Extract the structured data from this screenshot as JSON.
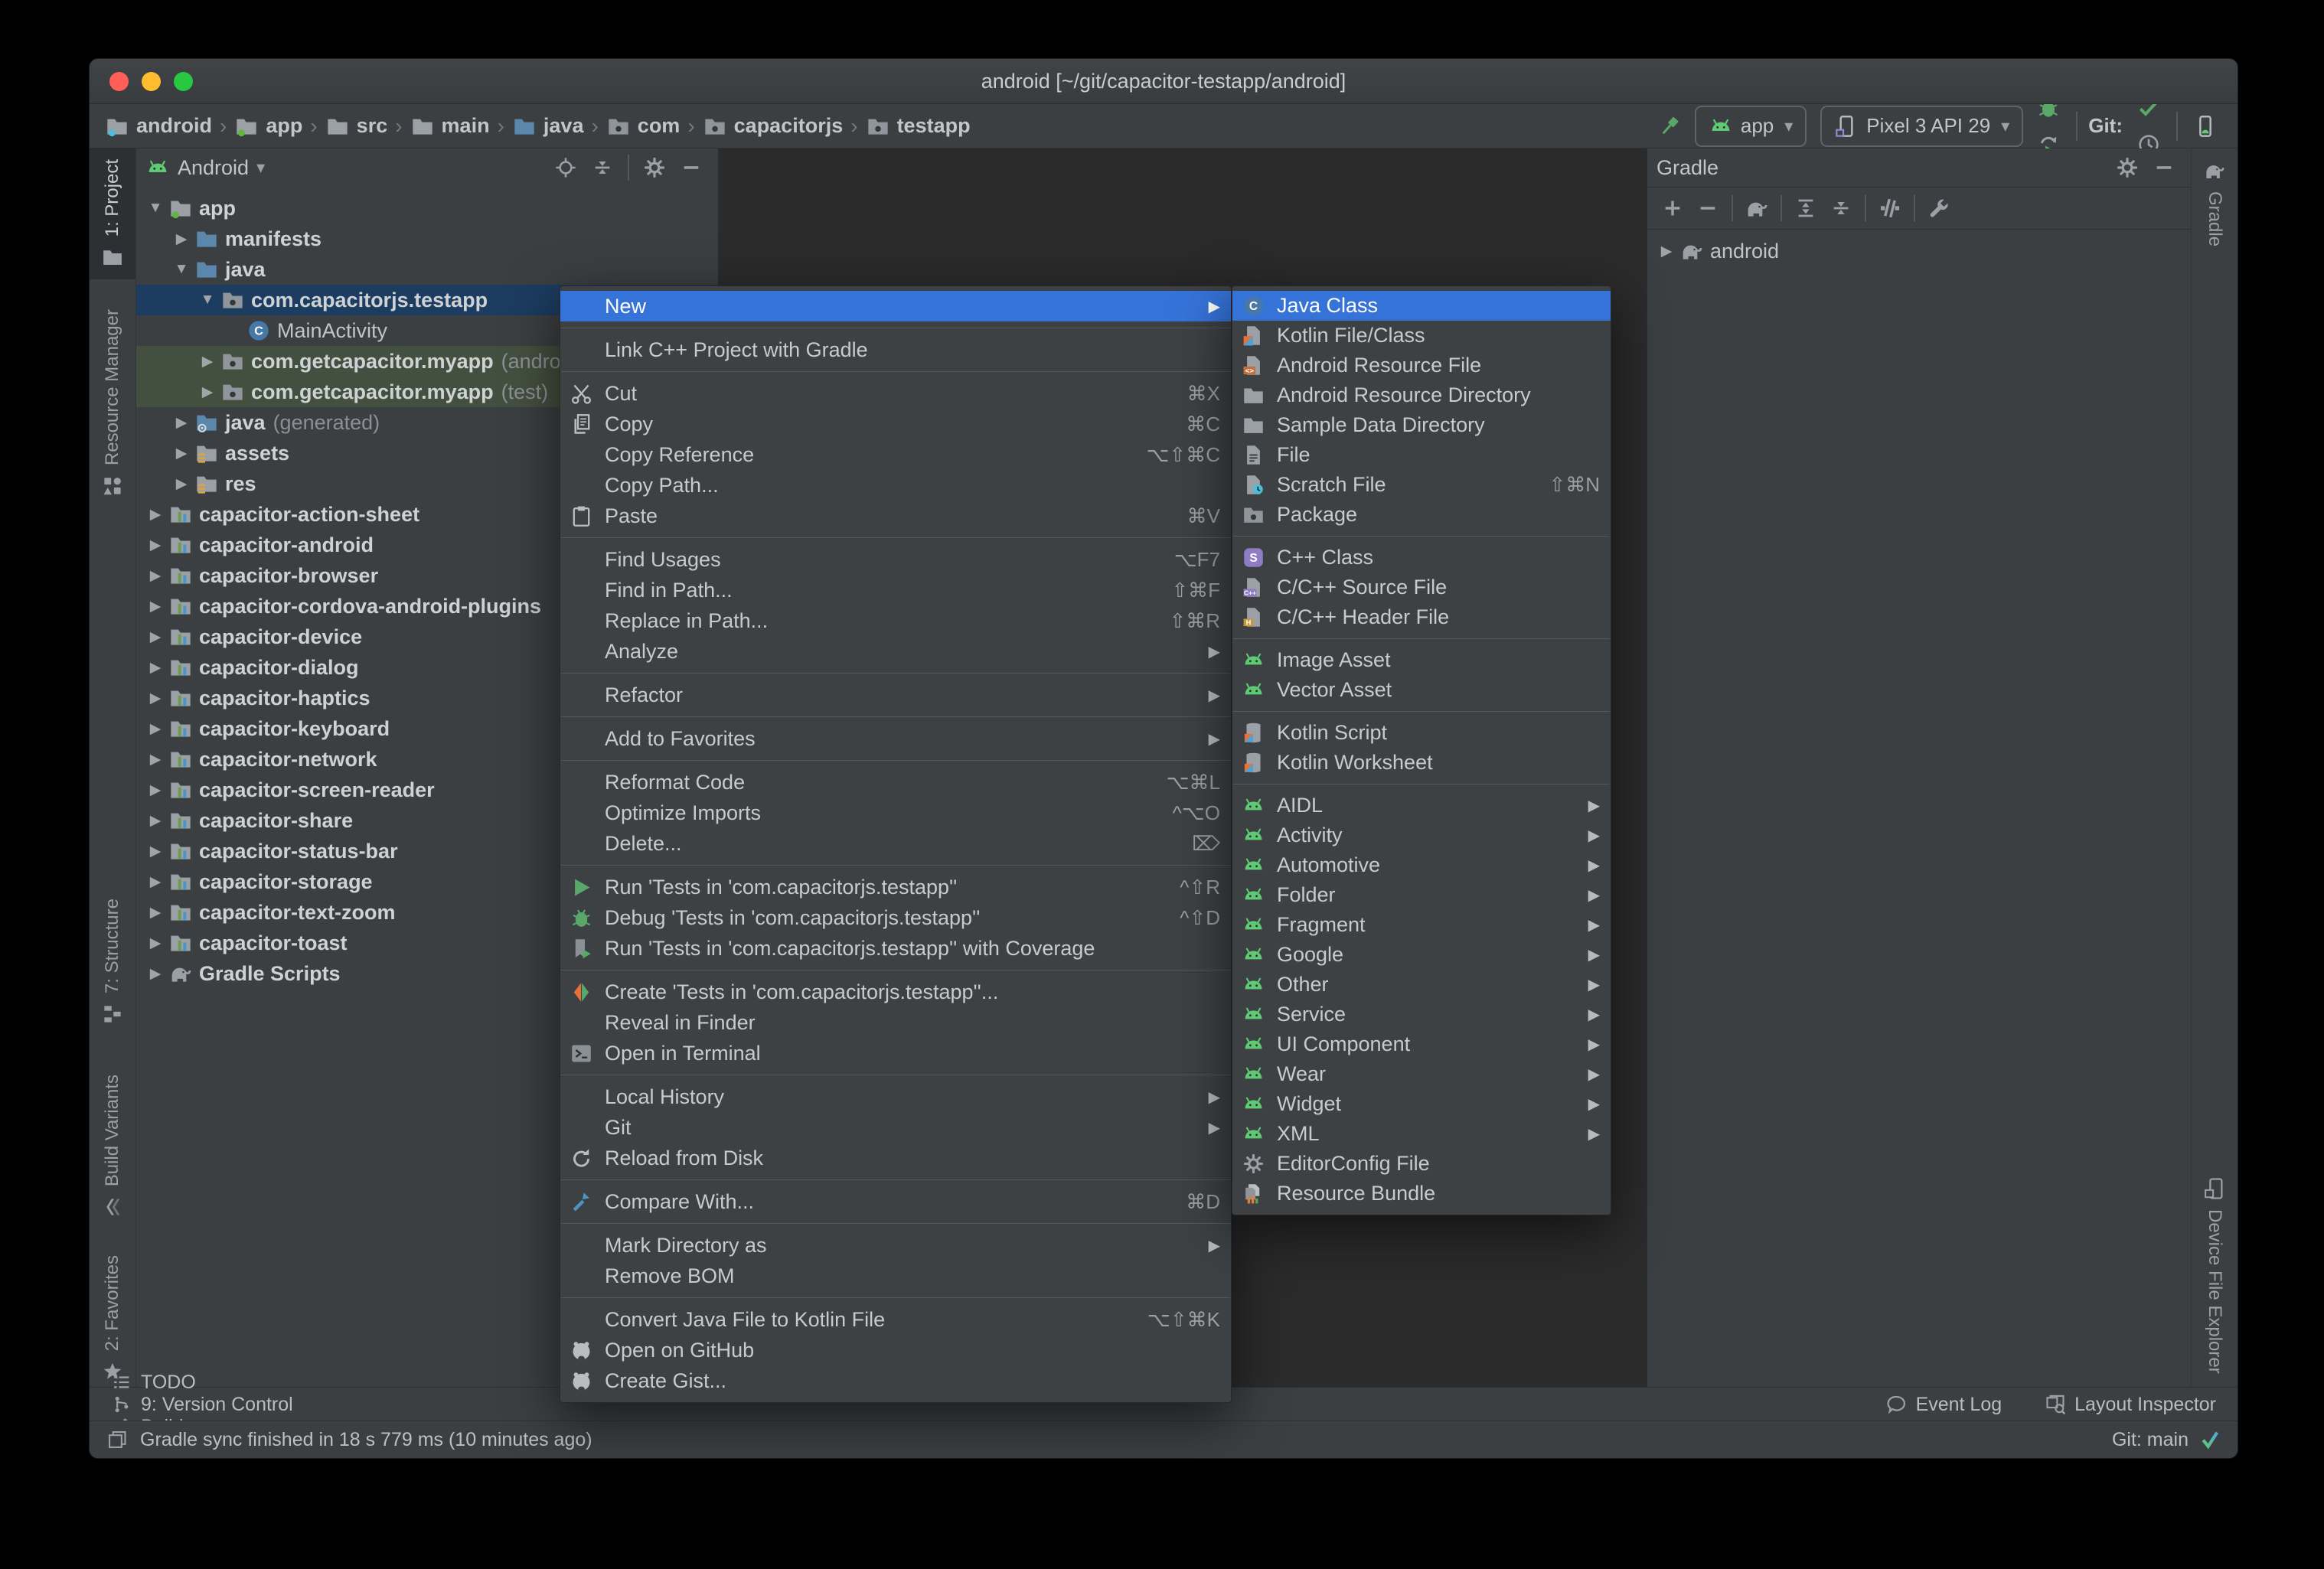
{
  "window": {
    "title": "android [~/git/capacitor-testapp/android]"
  },
  "toolbar": {
    "separator": "›",
    "breadcrumbs": [
      {
        "label": "android",
        "icon": "folder-android"
      },
      {
        "label": "app",
        "icon": "folder-app"
      },
      {
        "label": "src",
        "icon": "folder-grey"
      },
      {
        "label": "main",
        "icon": "folder-grey"
      },
      {
        "label": "java",
        "icon": "folder-blue"
      },
      {
        "label": "com",
        "icon": "package"
      },
      {
        "label": "capacitorjs",
        "icon": "package"
      },
      {
        "label": "testapp",
        "icon": "package"
      }
    ],
    "build_button": {
      "icon": "hammer-green"
    },
    "run_config": {
      "icon": "android-head",
      "label": "app",
      "caret": "▾"
    },
    "device_select": {
      "icon": "phone",
      "label": "Pixel 3 API 29",
      "caret": "▾"
    },
    "run_icons": [
      {
        "name": "run-button",
        "icon": "play-green"
      },
      {
        "name": "apply-changes-button",
        "icon": "rerun"
      },
      {
        "name": "apply-code-changes-button",
        "icon": "runlist"
      },
      {
        "name": "debug-button",
        "icon": "bug"
      },
      {
        "name": "attach-debugger-button",
        "icon": "attach"
      },
      {
        "name": "profiler-button",
        "icon": "gauge"
      },
      {
        "name": "profile-app-button",
        "icon": "profile-bug"
      },
      {
        "name": "stop-button",
        "icon": "stop"
      }
    ],
    "git_label": "Git:",
    "git_icons": [
      {
        "name": "update-project-button",
        "icon": "arrow-update"
      },
      {
        "name": "commit-button",
        "icon": "check"
      },
      {
        "name": "history-button",
        "icon": "clock"
      },
      {
        "name": "rollback-button",
        "icon": "rollback"
      }
    ],
    "tool_icons": [
      {
        "name": "tool-windows-button",
        "icon": "folders"
      },
      {
        "name": "run-anything-button",
        "icon": "run-window"
      },
      {
        "name": "sync-gradle-button",
        "icon": "elephant-sync"
      },
      {
        "name": "device-manager-button",
        "icon": "device-manager"
      },
      {
        "name": "sdk-manager-button",
        "icon": "sdk"
      },
      {
        "name": "search-everywhere-button",
        "icon": "search"
      },
      {
        "name": "profile-avatar",
        "icon": "avatar"
      }
    ]
  },
  "left_stripe": [
    {
      "label": "1: Project",
      "icon": "tab-folder",
      "active": true
    },
    {
      "label": "Resource Manager",
      "icon": "tab-resource",
      "active": false
    },
    {
      "label": "7: Structure",
      "icon": "tab-structure",
      "active": false
    },
    {
      "label": "Build Variants",
      "icon": "tab-variants",
      "active": false
    },
    {
      "label": "2: Favorites",
      "icon": "tab-star",
      "active": false
    }
  ],
  "right_stripe": [
    {
      "label": "Gradle",
      "icon": "elephant",
      "active": false
    },
    {
      "label": "Device File Explorer",
      "icon": "device-explorer",
      "active": false
    }
  ],
  "project_panel": {
    "title": "Android",
    "caret": "▾",
    "title_icon": "android-head",
    "header_icons": [
      {
        "name": "locate-button",
        "icon": "crosshair"
      },
      {
        "name": "collapse-all-button",
        "icon": "collapse"
      },
      {
        "name": "divider",
        "icon": "divider"
      },
      {
        "name": "settings-button",
        "icon": "gear"
      },
      {
        "name": "hide-panel-button",
        "icon": "minus"
      }
    ],
    "tree": [
      {
        "label": "app",
        "icon": "folder-app",
        "depth": 0,
        "arrow": "down",
        "bold": true
      },
      {
        "label": "manifests",
        "icon": "folder-blue",
        "depth": 1,
        "arrow": "right",
        "bold": true
      },
      {
        "label": "java",
        "icon": "folder-blue",
        "depth": 1,
        "arrow": "down",
        "bold": true
      },
      {
        "label": "com.capacitorjs.testapp",
        "icon": "package",
        "depth": 2,
        "arrow": "down",
        "bold": true,
        "state": "selected"
      },
      {
        "label": "MainActivity",
        "icon": "class-c",
        "depth": 3,
        "arrow": "none",
        "bold": false
      },
      {
        "label": "com.getcapacitor.myapp",
        "suffix": " (androidTest)",
        "icon": "package",
        "depth": 2,
        "arrow": "right",
        "bold": true,
        "state": "test"
      },
      {
        "label": "com.getcapacitor.myapp",
        "suffix": " (test)",
        "icon": "package",
        "depth": 2,
        "arrow": "right",
        "bold": true,
        "state": "test"
      },
      {
        "label": "java",
        "suffix": " (generated)",
        "icon": "folder-gen",
        "depth": 1,
        "arrow": "right",
        "bold": true
      },
      {
        "label": "assets",
        "icon": "folder-lines",
        "depth": 1,
        "arrow": "right",
        "bold": true
      },
      {
        "label": "res",
        "icon": "folder-lines",
        "depth": 1,
        "arrow": "right",
        "bold": true
      },
      {
        "label": "capacitor-action-sheet",
        "icon": "module",
        "depth": 0,
        "arrow": "right",
        "bold": true
      },
      {
        "label": "capacitor-android",
        "icon": "module",
        "depth": 0,
        "arrow": "right",
        "bold": true
      },
      {
        "label": "capacitor-browser",
        "icon": "module",
        "depth": 0,
        "arrow": "right",
        "bold": true
      },
      {
        "label": "capacitor-cordova-android-plugins",
        "icon": "module",
        "depth": 0,
        "arrow": "right",
        "bold": true
      },
      {
        "label": "capacitor-device",
        "icon": "module",
        "depth": 0,
        "arrow": "right",
        "bold": true
      },
      {
        "label": "capacitor-dialog",
        "icon": "module",
        "depth": 0,
        "arrow": "right",
        "bold": true
      },
      {
        "label": "capacitor-haptics",
        "icon": "module",
        "depth": 0,
        "arrow": "right",
        "bold": true
      },
      {
        "label": "capacitor-keyboard",
        "icon": "module",
        "depth": 0,
        "arrow": "right",
        "bold": true
      },
      {
        "label": "capacitor-network",
        "icon": "module",
        "depth": 0,
        "arrow": "right",
        "bold": true
      },
      {
        "label": "capacitor-screen-reader",
        "icon": "module",
        "depth": 0,
        "arrow": "right",
        "bold": true
      },
      {
        "label": "capacitor-share",
        "icon": "module",
        "depth": 0,
        "arrow": "right",
        "bold": true
      },
      {
        "label": "capacitor-status-bar",
        "icon": "module",
        "depth": 0,
        "arrow": "right",
        "bold": true
      },
      {
        "label": "capacitor-storage",
        "icon": "module",
        "depth": 0,
        "arrow": "right",
        "bold": true
      },
      {
        "label": "capacitor-text-zoom",
        "icon": "module",
        "depth": 0,
        "arrow": "right",
        "bold": true
      },
      {
        "label": "capacitor-toast",
        "icon": "module",
        "depth": 0,
        "arrow": "right",
        "bold": true
      },
      {
        "label": "Gradle Scripts",
        "icon": "elephant",
        "depth": 0,
        "arrow": "right",
        "bold": true
      }
    ]
  },
  "context_menu": {
    "sections": [
      [
        {
          "label": "New",
          "arrow": true,
          "selected": true
        }
      ],
      [
        {
          "label": "Link C++ Project with Gradle"
        }
      ],
      [
        {
          "label": "Cut",
          "icon": "scissors",
          "shortcut": "⌘X"
        },
        {
          "label": "Copy",
          "icon": "copy",
          "shortcut": "⌘C"
        },
        {
          "label": "Copy Reference",
          "shortcut": "⌥⇧⌘C"
        },
        {
          "label": "Copy Path..."
        },
        {
          "label": "Paste",
          "icon": "paste",
          "shortcut": "⌘V"
        }
      ],
      [
        {
          "label": "Find Usages",
          "shortcut": "⌥F7"
        },
        {
          "label": "Find in Path...",
          "shortcut": "⇧⌘F"
        },
        {
          "label": "Replace in Path...",
          "shortcut": "⇧⌘R"
        },
        {
          "label": "Analyze",
          "arrow": true
        }
      ],
      [
        {
          "label": "Refactor",
          "arrow": true
        }
      ],
      [
        {
          "label": "Add to Favorites",
          "arrow": true
        }
      ],
      [
        {
          "label": "Reformat Code",
          "shortcut": "⌥⌘L"
        },
        {
          "label": "Optimize Imports",
          "shortcut": "^⌥O"
        },
        {
          "label": "Delete...",
          "shortcut": "⌦"
        }
      ],
      [
        {
          "label": "Run 'Tests in 'com.capacitorjs.testapp''",
          "icon": "play-green",
          "shortcut": "^⇧R"
        },
        {
          "label": "Debug 'Tests in 'com.capacitorjs.testapp''",
          "icon": "bug",
          "shortcut": "^⇧D"
        },
        {
          "label": "Run 'Tests in 'com.capacitorjs.testapp'' with Coverage",
          "icon": "coverage"
        }
      ],
      [
        {
          "label": "Create 'Tests in 'com.capacitorjs.testapp''...",
          "icon": "diamond"
        },
        {
          "label": "Reveal in Finder"
        },
        {
          "label": "Open in Terminal",
          "icon": "terminal"
        }
      ],
      [
        {
          "label": "Local History",
          "arrow": true
        },
        {
          "label": "Git",
          "arrow": true
        },
        {
          "label": "Reload from Disk",
          "icon": "reload"
        }
      ],
      [
        {
          "label": "Compare With...",
          "icon": "compare",
          "shortcut": "⌘D"
        }
      ],
      [
        {
          "label": "Mark Directory as",
          "arrow": true
        },
        {
          "label": "Remove BOM"
        }
      ],
      [
        {
          "label": "Convert Java File to Kotlin File",
          "shortcut": "⌥⇧⌘K"
        },
        {
          "label": "Open on GitHub",
          "icon": "github"
        },
        {
          "label": "Create Gist...",
          "icon": "github"
        }
      ]
    ]
  },
  "new_submenu": {
    "sections": [
      [
        {
          "label": "Java Class",
          "icon": "class-c",
          "selected": true
        },
        {
          "label": "Kotlin File/Class",
          "icon": "kotlin-file"
        },
        {
          "label": "Android Resource File",
          "icon": "xml-file"
        },
        {
          "label": "Android Resource Directory",
          "icon": "folder-grey"
        },
        {
          "label": "Sample Data Directory",
          "icon": "folder-grey"
        },
        {
          "label": "File",
          "icon": "file"
        },
        {
          "label": "Scratch File",
          "icon": "scratch",
          "shortcut": "⇧⌘N"
        },
        {
          "label": "Package",
          "icon": "package"
        }
      ],
      [
        {
          "label": "C++ Class",
          "icon": "s-purple"
        },
        {
          "label": "C/C++ Source File",
          "icon": "cpp-file"
        },
        {
          "label": "C/C++ Header File",
          "icon": "h-file"
        }
      ],
      [
        {
          "label": "Image Asset",
          "icon": "android-head"
        },
        {
          "label": "Vector Asset",
          "icon": "android-head"
        }
      ],
      [
        {
          "label": "Kotlin Script",
          "icon": "kotlin-scroll"
        },
        {
          "label": "Kotlin Worksheet",
          "icon": "kotlin-scroll"
        }
      ],
      [
        {
          "label": "AIDL",
          "icon": "android-head",
          "arrow": true
        },
        {
          "label": "Activity",
          "icon": "android-head",
          "arrow": true
        },
        {
          "label": "Automotive",
          "icon": "android-head",
          "arrow": true
        },
        {
          "label": "Folder",
          "icon": "android-head",
          "arrow": true
        },
        {
          "label": "Fragment",
          "icon": "android-head",
          "arrow": true
        },
        {
          "label": "Google",
          "icon": "android-head",
          "arrow": true
        },
        {
          "label": "Other",
          "icon": "android-head",
          "arrow": true
        },
        {
          "label": "Service",
          "icon": "android-head",
          "arrow": true
        },
        {
          "label": "UI Component",
          "icon": "android-head",
          "arrow": true
        },
        {
          "label": "Wear",
          "icon": "android-head",
          "arrow": true
        },
        {
          "label": "Widget",
          "icon": "android-head",
          "arrow": true
        },
        {
          "label": "XML",
          "icon": "android-head",
          "arrow": true
        },
        {
          "label": "EditorConfig File",
          "icon": "gear"
        },
        {
          "label": "Resource Bundle",
          "icon": "bundle"
        }
      ]
    ]
  },
  "gradle_panel": {
    "title": "Gradle",
    "header_icons": [
      {
        "name": "settings-button",
        "icon": "gear"
      },
      {
        "name": "hide-panel-button",
        "icon": "minus"
      }
    ],
    "toolbar": [
      {
        "name": "refresh-add-button",
        "icon": "plus"
      },
      {
        "name": "detach-button",
        "icon": "minus"
      },
      {
        "name": "divider",
        "icon": "divider"
      },
      {
        "name": "sync-button",
        "icon": "elephant"
      },
      {
        "name": "divider",
        "icon": "divider"
      },
      {
        "name": "expand-all-button",
        "icon": "expand"
      },
      {
        "name": "collapse-all-button",
        "icon": "collapse"
      },
      {
        "name": "divider",
        "icon": "divider"
      },
      {
        "name": "offline-mode-button",
        "icon": "bars"
      },
      {
        "name": "divider",
        "icon": "divider"
      },
      {
        "name": "gradle-settings-button",
        "icon": "wrench"
      }
    ],
    "tree": [
      {
        "label": "android",
        "icon": "elephant",
        "depth": 0,
        "arrow": "right",
        "bold": false
      }
    ]
  },
  "bottom_bar": {
    "left": [
      {
        "label": "TODO",
        "icon": "todo"
      },
      {
        "label": "9: Version Control",
        "icon": "branch"
      },
      {
        "label": "Build",
        "icon": "hammer-grey"
      }
    ],
    "right": [
      {
        "label": "Event Log",
        "icon": "balloon"
      },
      {
        "label": "Layout Inspector",
        "icon": "layout-search"
      }
    ]
  },
  "status_bar": {
    "icon": "layers",
    "message": "Gradle sync finished in 18 s 779 ms (10 minutes ago)",
    "git_branch": "Git: main",
    "git_icon": "git-check"
  }
}
